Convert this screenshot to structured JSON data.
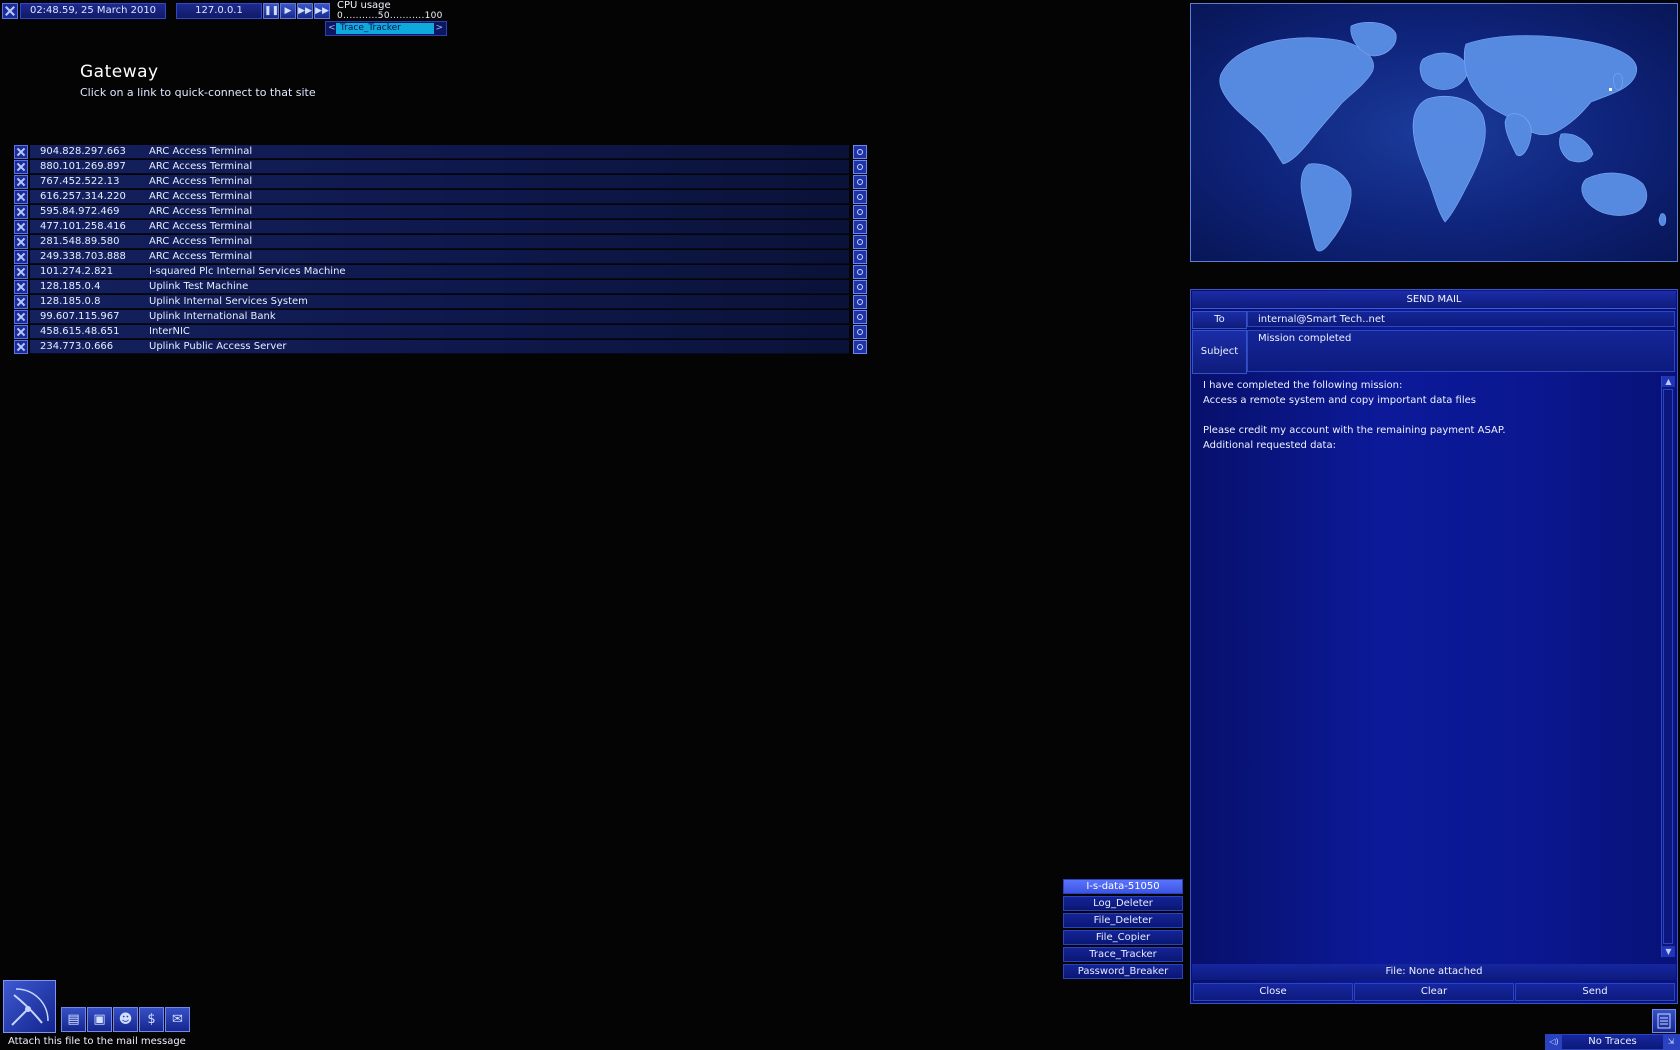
{
  "topbar": {
    "datetime": "02:48.59, 25 March 2010",
    "ip": "127.0.0.1",
    "controls": [
      "pause-icon",
      "play-icon",
      "fast-forward-icon",
      "fastest-icon"
    ],
    "cpu_label": "CPU usage",
    "cpu_scale": "0...........50...........100",
    "cpu_program": "Trace_Tracker"
  },
  "page": {
    "title": "Gateway",
    "subtitle": "Click on a link to quick-connect to that site"
  },
  "links": [
    {
      "ip": "904.828.297.663",
      "name": "ARC Access Terminal"
    },
    {
      "ip": "880.101.269.897",
      "name": "ARC Access Terminal"
    },
    {
      "ip": "767.452.522.13",
      "name": "ARC Access Terminal"
    },
    {
      "ip": "616.257.314.220",
      "name": "ARC Access Terminal"
    },
    {
      "ip": "595.84.972.469",
      "name": "ARC Access Terminal"
    },
    {
      "ip": "477.101.258.416",
      "name": "ARC Access Terminal"
    },
    {
      "ip": "281.548.89.580",
      "name": "ARC Access Terminal"
    },
    {
      "ip": "249.338.703.888",
      "name": "ARC Access Terminal"
    },
    {
      "ip": "101.274.2.821",
      "name": "I-squared Plc Internal Services Machine"
    },
    {
      "ip": "128.185.0.4",
      "name": "Uplink Test Machine"
    },
    {
      "ip": "128.185.0.8",
      "name": "Uplink Internal Services System"
    },
    {
      "ip": "99.607.115.967",
      "name": "Uplink International Bank"
    },
    {
      "ip": "458.615.48.651",
      "name": "InterNIC"
    },
    {
      "ip": "234.773.0.666",
      "name": "Uplink Public Access Server"
    }
  ],
  "mail": {
    "header": "SEND MAIL",
    "to_label": "To",
    "to_value": "internal@Smart Tech..net",
    "subject_label": "Subject",
    "subject_value": "Mission completed",
    "body": "I have completed the following mission:\nAccess a remote system and copy important data files\n\nPlease credit my account with the remaining payment ASAP.\nAdditional requested data:",
    "file_status": "File: None attached",
    "buttons": {
      "close": "Close",
      "clear": "Clear",
      "send": "Send"
    }
  },
  "software": [
    {
      "label": "I-s-data-51050",
      "selected": true
    },
    {
      "label": "Log_Deleter",
      "selected": false
    },
    {
      "label": "File_Deleter",
      "selected": false
    },
    {
      "label": "File_Copier",
      "selected": false
    },
    {
      "label": "Trace_Tracker",
      "selected": false
    },
    {
      "label": "Password_Breaker",
      "selected": false
    }
  ],
  "toolbar": {
    "icons": [
      "software-icon",
      "hardware-icon",
      "personal-icon",
      "finance-icon",
      "email-icon"
    ],
    "finance_glyph": "$",
    "tooltip": "Attach this file to the mail message"
  },
  "traces": {
    "label": "No Traces"
  },
  "colors": {
    "background": "#040404",
    "panel": "#0c1a9a",
    "accent": "#3d55e2",
    "highlight": "#10c4f2"
  }
}
